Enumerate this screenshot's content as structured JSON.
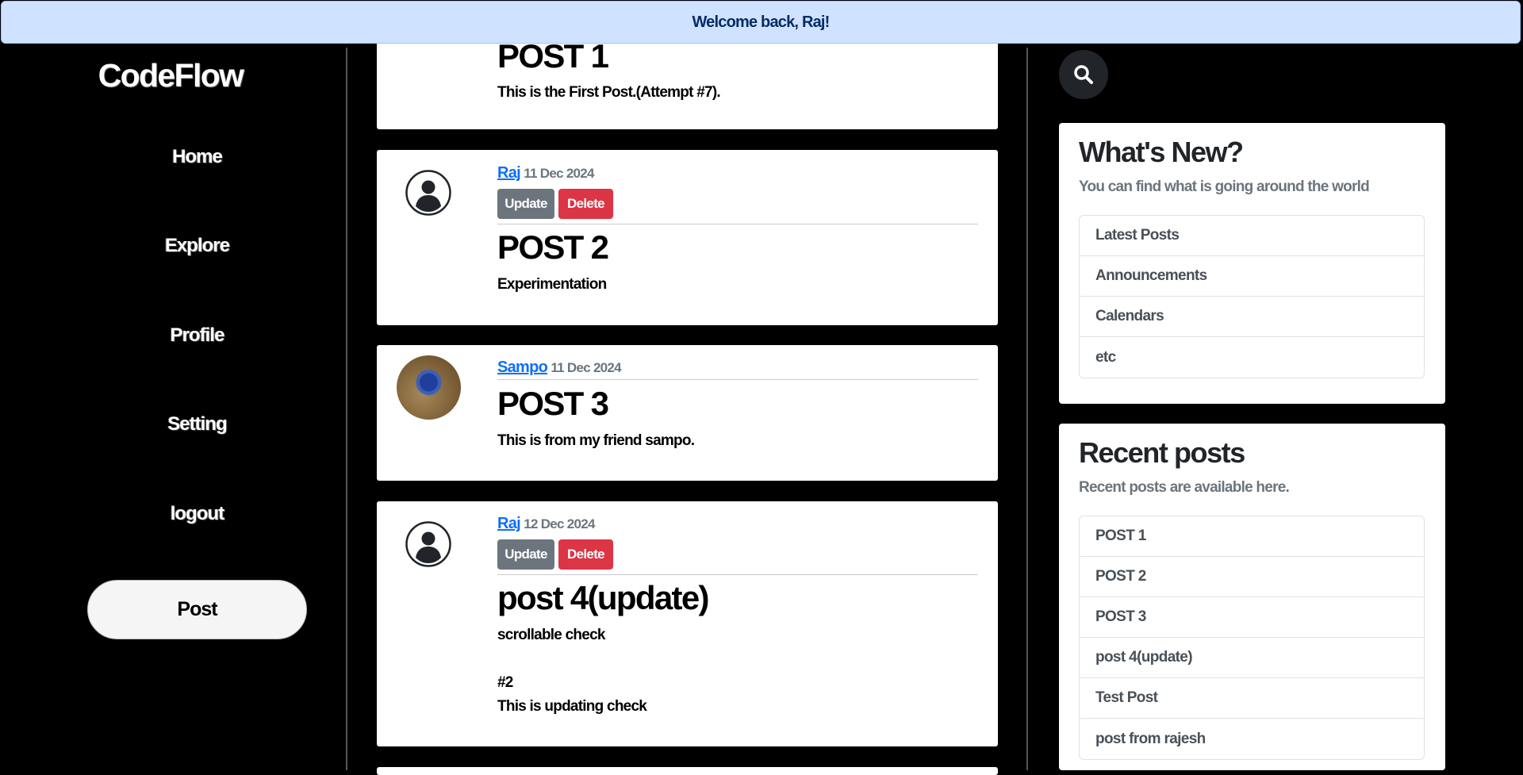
{
  "alert": {
    "text": "Welcome back, Raj!"
  },
  "sidebar": {
    "brand": "CodeFlow",
    "items": [
      {
        "label": "Home"
      },
      {
        "label": "Explore"
      },
      {
        "label": "Profile"
      },
      {
        "label": "Setting"
      },
      {
        "label": "logout"
      }
    ],
    "post_button": "Post"
  },
  "posts": [
    {
      "title": "POST 1",
      "body": "This is the First Post.(Attempt #7)."
    },
    {
      "author": "Raj",
      "date": "11 Dec 2024",
      "update": "Update",
      "delete": "Delete",
      "title": "POST 2",
      "body": "Experimentation"
    },
    {
      "author": "Sampo",
      "date": "11 Dec 2024",
      "title": "POST 3",
      "body": "This is from my friend sampo."
    },
    {
      "author": "Raj",
      "date": "12 Dec 2024",
      "update": "Update",
      "delete": "Delete",
      "title": "post 4(update)",
      "body": "scrollable check\n\n#2\nThis is updating check"
    }
  ],
  "whats_new": {
    "title": "What's New?",
    "subtitle": "You can find what is going around the world",
    "items": [
      "Latest Posts",
      "Announcements",
      "Calendars",
      "etc"
    ]
  },
  "recent": {
    "title": "Recent posts",
    "subtitle": "Recent posts are available here.",
    "items": [
      "POST 1",
      "POST 2",
      "POST 3",
      "post 4(update)",
      "Test Post",
      "post from rajesh"
    ]
  },
  "icons": {
    "search": "search-icon",
    "avatar": "user-avatar-icon"
  }
}
